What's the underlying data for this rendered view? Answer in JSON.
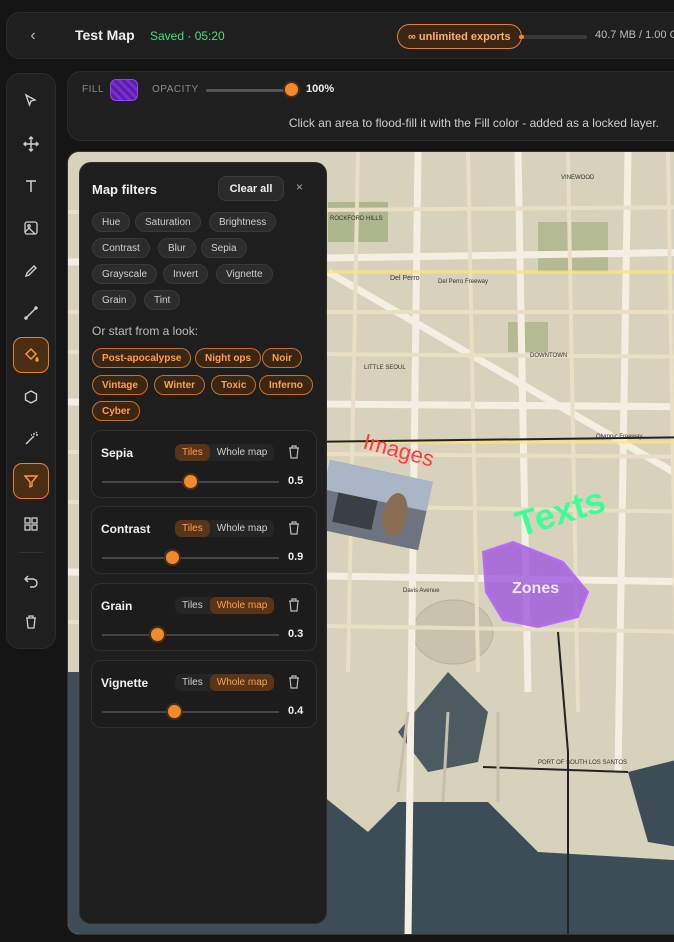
{
  "header": {
    "back_icon": "chevron-left-icon",
    "title": "Test Map",
    "saved_status": "Saved · 05:20",
    "exports_badge": "∞ unlimited exports",
    "storage_fraction": 0.02,
    "storage_text": "40.7 MB / 1.00 G"
  },
  "toolbar": {
    "tools": [
      "select-icon",
      "move-icon",
      "text-icon",
      "image-icon",
      "pencil-icon",
      "line-icon",
      "fill-bucket-icon",
      "polygon-icon",
      "magic-wand-icon",
      "filter-icon",
      "grid-icon",
      "undo-icon",
      "trash-icon"
    ],
    "active": [
      "fill-bucket-icon",
      "filter-icon"
    ]
  },
  "fillbar": {
    "fill_label": "FILL",
    "fill_color": "#7a2bd1",
    "opacity_label": "OPACITY",
    "opacity_value": "100%",
    "hint": "Click an area to flood-fill it with the Fill color - added as a locked layer."
  },
  "map": {
    "overlay_images_label": "Images",
    "overlay_texts_label": "Texts",
    "overlay_zones_label": "Zones",
    "place_labels": [
      "VINEWOOD",
      "ROCKFORD HILLS",
      "Del Perro",
      "Del Perro Freeway",
      "LITTLE SEOUL",
      "DOWNTOWN",
      "Olympic Freeway",
      "Davis Avenue",
      "PORT OF SOUTH LOS SANTOS"
    ]
  },
  "filters_panel": {
    "title": "Map filters",
    "clear_all": "Clear all",
    "close": "×",
    "filter_chips": [
      "Hue",
      "Saturation",
      "Brightness",
      "Contrast",
      "Blur",
      "Sepia",
      "Grayscale",
      "Invert",
      "Vignette",
      "Grain",
      "Tint"
    ],
    "look_label": "Or start from a look:",
    "looks": [
      "Post-apocalypse",
      "Night ops",
      "Noir",
      "Vintage",
      "Winter",
      "Toxic",
      "Inferno",
      "Cyber"
    ],
    "tiles_label": "Tiles",
    "whole_map_label": "Whole map",
    "active_filters": [
      {
        "name": "Sepia",
        "scope": "Tiles",
        "value": "0.5"
      },
      {
        "name": "Contrast",
        "scope": "Tiles",
        "value": "0.9"
      },
      {
        "name": "Grain",
        "scope": "Whole map",
        "value": "0.3"
      },
      {
        "name": "Vignette",
        "scope": "Whole map",
        "value": "0.4"
      }
    ]
  }
}
